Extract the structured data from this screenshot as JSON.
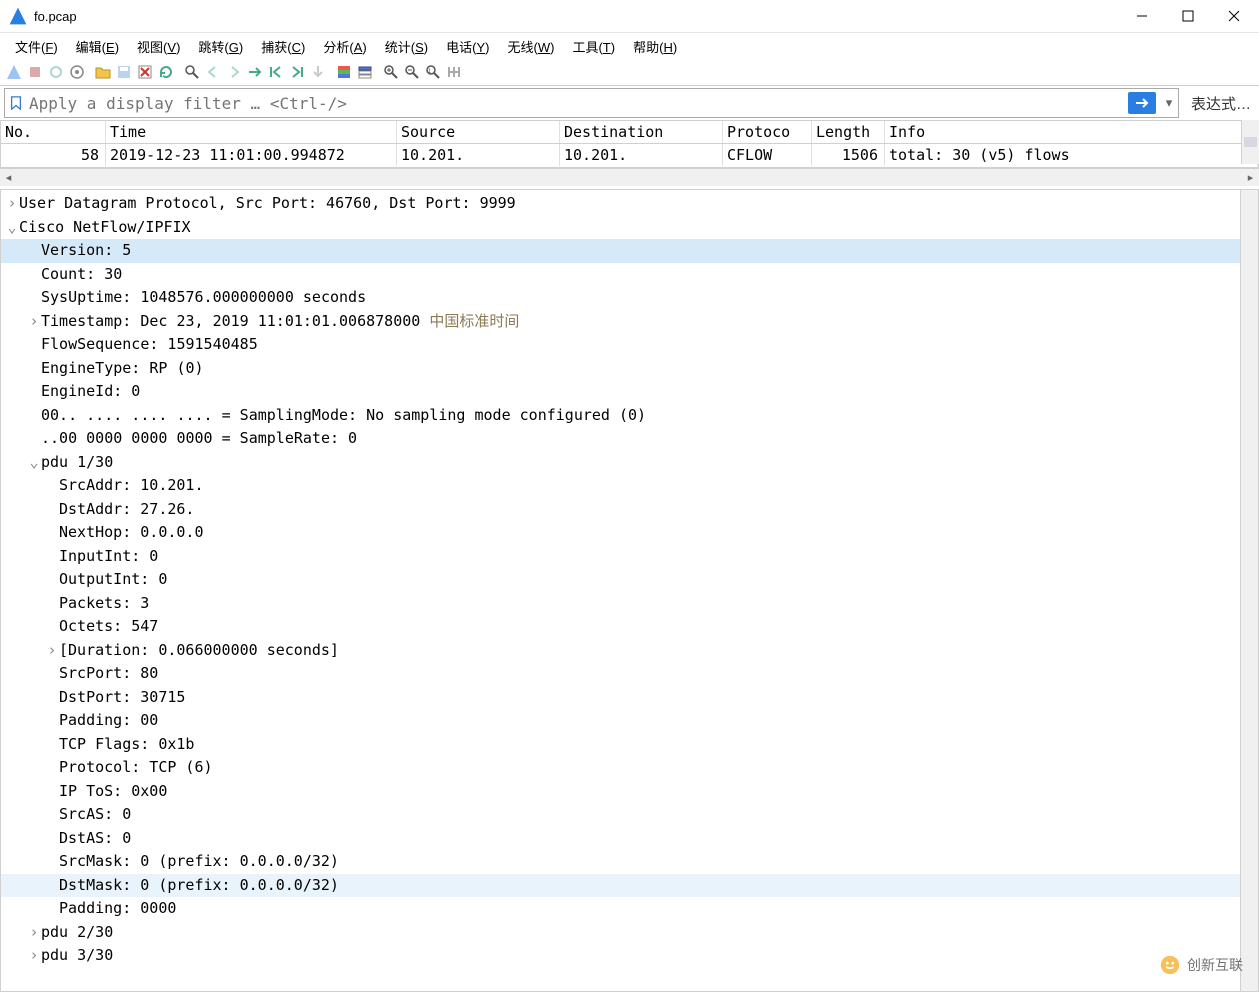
{
  "window": {
    "title": "fo.pcap"
  },
  "menus": {
    "file": {
      "label": "文件",
      "accel": "F"
    },
    "edit": {
      "label": "编辑",
      "accel": "E"
    },
    "view": {
      "label": "视图",
      "accel": "V"
    },
    "go": {
      "label": "跳转",
      "accel": "G"
    },
    "capture": {
      "label": "捕获",
      "accel": "C"
    },
    "analyze": {
      "label": "分析",
      "accel": "A"
    },
    "stats": {
      "label": "统计",
      "accel": "S"
    },
    "telephony": {
      "label": "电话",
      "accel": "Y"
    },
    "wireless": {
      "label": "无线",
      "accel": "W"
    },
    "tools": {
      "label": "工具",
      "accel": "T"
    },
    "help": {
      "label": "帮助",
      "accel": "H"
    }
  },
  "filter": {
    "placeholder": "Apply a display filter … <Ctrl-/>",
    "expression_label": "表达式…"
  },
  "packet_list": {
    "columns": {
      "no": "No.",
      "time": "Time",
      "source": "Source",
      "dest": "Destination",
      "proto": "Protoco",
      "length": "Length",
      "info": "Info"
    },
    "rows": [
      {
        "no": "58",
        "time": "2019-12-23 11:01:00.994872",
        "source": "10.201.",
        "dest": "10.201.",
        "proto": "CFLOW",
        "length": "1506",
        "info": "total: 30 (v5) flows"
      }
    ]
  },
  "details": {
    "udp": "User Datagram Protocol, Src Port: 46760, Dst Port: 9999",
    "netflow": "Cisco NetFlow/IPFIX",
    "fields": {
      "version": "Version: 5",
      "count": "Count: 30",
      "sysuptime": "SysUptime: 1048576.000000000 seconds",
      "timestamp": "Timestamp: Dec 23, 2019 11:01:01.006878000 ",
      "timestamp_tz": "中国标准时间",
      "flowseq": "FlowSequence: 1591540485",
      "enginetype": "EngineType: RP (0)",
      "engineid": "EngineId: 0",
      "samplingmode": "00.. .... .... .... = SamplingMode: No sampling mode configured (0)",
      "samplerate": "..00 0000 0000 0000 = SampleRate: 0"
    },
    "pdu1": {
      "label": "pdu 1/30",
      "srcaddr": "SrcAddr: 10.201.",
      "dstaddr": "DstAddr: 27.26.",
      "nexthop": "NextHop: 0.0.0.0",
      "inputint": "InputInt: 0",
      "outputint": "OutputInt: 0",
      "packets": "Packets: 3",
      "octets": "Octets: 547",
      "duration": "[Duration: 0.066000000 seconds]",
      "srcport": "SrcPort: 80",
      "dstport": "DstPort: 30715",
      "padding": "Padding: 00",
      "tcpflags": "TCP Flags: 0x1b",
      "protocol": "Protocol: TCP (6)",
      "iptos": "IP ToS: 0x00",
      "srcas": "SrcAS: 0",
      "dstas": "DstAS: 0",
      "srcmask": "SrcMask: 0 (prefix: 0.0.0.0/32)",
      "dstmask": "DstMask: 0 (prefix: 0.0.0.0/32)",
      "padding2": "Padding: 0000"
    },
    "pdu2": "pdu 2/30",
    "pdu3": "pdu 3/30"
  },
  "watermark": "创新互联"
}
